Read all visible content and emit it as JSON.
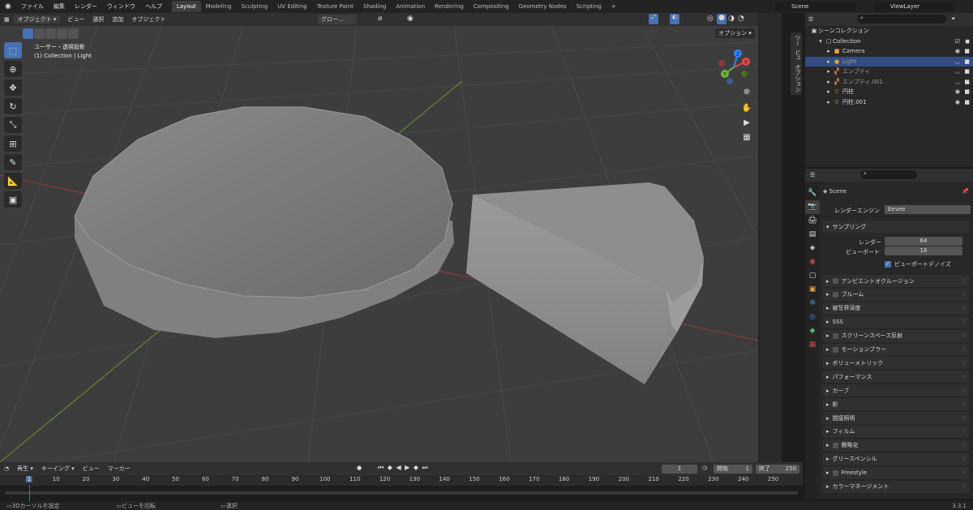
{
  "topbar": {
    "menus": [
      "ファイル",
      "編集",
      "レンダー",
      "ウィンドウ",
      "ヘルプ"
    ],
    "workspaces": [
      "Layout",
      "Modeling",
      "Sculpting",
      "UV Editing",
      "Texture Paint",
      "Shading",
      "Animation",
      "Rendering",
      "Compositing",
      "Geometry Nodes",
      "Scripting"
    ],
    "active_workspace": "Layout",
    "add_tab": "+",
    "scene": "Scene",
    "view_layer": "ViewLayer"
  },
  "viewport_header": {
    "mode": "オブジェクト ▾",
    "menus": [
      "ビュー",
      "選択",
      "追加",
      "オブジェクト"
    ],
    "orientation": "グロー...",
    "options": "オプション ▾"
  },
  "viewport": {
    "view_name": "ユーザー・透視投影",
    "context": "(1) Collection | Light",
    "gizmo_axes": [
      "X",
      "Y",
      "Z"
    ]
  },
  "side_tabs": [
    "ツール",
    "ビュー",
    "オプション"
  ],
  "outliner": {
    "root": "シーンコレクション",
    "collection": "Collection",
    "items": [
      {
        "name": "Camera",
        "icon": "camera-icon",
        "color": "#e8a23a",
        "selected": false,
        "muted": false
      },
      {
        "name": "Light",
        "icon": "light-icon",
        "color": "#e8a23a",
        "selected": true,
        "muted": true
      },
      {
        "name": "エンプティ",
        "icon": "empty-icon",
        "color": "#c1793f",
        "selected": false,
        "muted": true
      },
      {
        "name": "エンプティ.001",
        "icon": "empty-icon",
        "color": "#c1793f",
        "selected": false,
        "muted": true
      },
      {
        "name": "円柱",
        "icon": "mesh-icon",
        "color": "#e8a23a",
        "selected": false,
        "muted": false
      },
      {
        "name": "円柱.001",
        "icon": "mesh-icon",
        "color": "#e8a23a",
        "selected": false,
        "muted": false
      }
    ]
  },
  "properties": {
    "scene_label": "Scene",
    "render_engine_label": "レンダーエンジン",
    "render_engine_value": "Eevee",
    "sampling": {
      "title": "サンプリング",
      "render_label": "レンダー",
      "render_value": "64",
      "viewport_label": "ビューポート",
      "viewport_value": "16",
      "denoise_label": "ビューポートデノイズ"
    },
    "panels": [
      {
        "label": "アンビエントオクルージョン",
        "checkbox": true
      },
      {
        "label": "ブルーム",
        "checkbox": true
      },
      {
        "label": "被写界深度",
        "checkbox": false
      },
      {
        "label": "SSS",
        "checkbox": false
      },
      {
        "label": "スクリーンスペース反射",
        "checkbox": true
      },
      {
        "label": "モーションブラー",
        "checkbox": true
      },
      {
        "label": "ボリューメトリック",
        "checkbox": false
      },
      {
        "label": "パフォーマンス",
        "checkbox": false
      },
      {
        "label": "カーブ",
        "checkbox": false
      },
      {
        "label": "影",
        "checkbox": false
      },
      {
        "label": "間接照明",
        "checkbox": false
      },
      {
        "label": "フィルム",
        "checkbox": false
      },
      {
        "label": "簡略化",
        "checkbox": true
      },
      {
        "label": "グリースペンシル",
        "checkbox": false
      },
      {
        "label": "Freestyle",
        "checkbox": true
      },
      {
        "label": "カラーマネージメント",
        "checkbox": false
      }
    ]
  },
  "timeline": {
    "menus": [
      "再生 ▾",
      "キーイング ▾",
      "ビュー",
      "マーカー"
    ],
    "current_frame": "1",
    "start_label": "開始",
    "start_value": "1",
    "end_label": "終了",
    "end_value": "250",
    "ruler": [
      "1",
      "10",
      "20",
      "30",
      "40",
      "50",
      "60",
      "70",
      "80",
      "90",
      "100",
      "110",
      "120",
      "130",
      "140",
      "150",
      "160",
      "170",
      "180",
      "190",
      "200",
      "210",
      "220",
      "230",
      "240",
      "250"
    ]
  },
  "statusbar": {
    "items": [
      "3Dカーソルを設定",
      "ビューを回転",
      "選択"
    ],
    "version": "3.3.1"
  }
}
